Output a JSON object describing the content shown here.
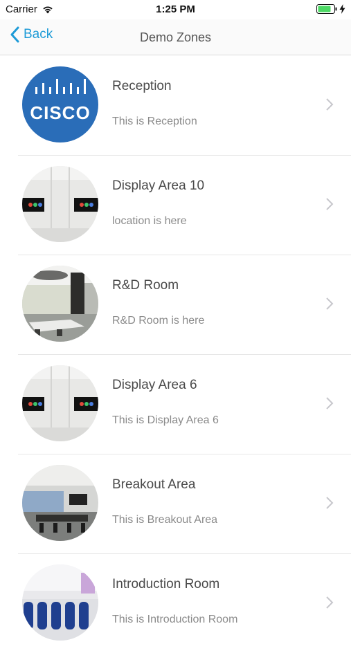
{
  "status": {
    "carrier": "Carrier",
    "time": "1:25 PM"
  },
  "nav": {
    "back_label": "Back",
    "title": "Demo Zones"
  },
  "zones": [
    {
      "title": "Reception",
      "subtitle": "This is Reception",
      "image": "cisco-logo"
    },
    {
      "title": "Display Area 10",
      "subtitle": "location is here",
      "image": "display-wall-photo"
    },
    {
      "title": "R&D Room",
      "subtitle": "R&D Room is here",
      "image": "office-room-photo"
    },
    {
      "title": "Display Area 6",
      "subtitle": "This is Display Area 6",
      "image": "display-wall-photo"
    },
    {
      "title": "Breakout Area",
      "subtitle": "This is Breakout Area",
      "image": "meeting-room-photo"
    },
    {
      "title": "Introduction Room",
      "subtitle": "This is Introduction Room",
      "image": "chairs-room-photo"
    }
  ],
  "colors": {
    "accent": "#1e9bd7",
    "cisco_blue": "#1f6fbf",
    "battery": "#4cd964"
  }
}
